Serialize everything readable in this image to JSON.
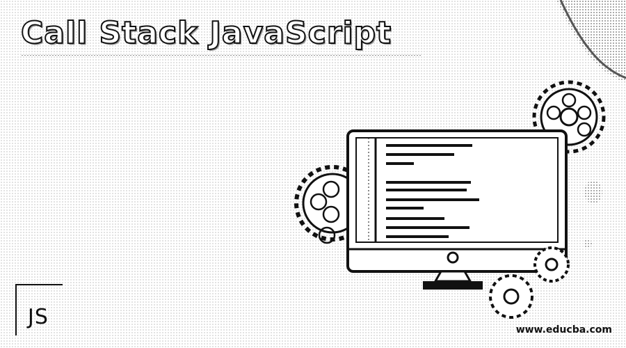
{
  "header": {
    "title": "Call Stack JavaScript"
  },
  "badge": {
    "label": "JS"
  },
  "footer": {
    "url": "www.educba.com"
  },
  "illustration": {
    "icons": [
      "monitor-icon",
      "gear-icon",
      "code-line-icon",
      "corner-swoosh-icon"
    ],
    "colors": {
      "ink": "#111111",
      "paper": "#ffffff",
      "dots": "#c9c9c9"
    }
  }
}
